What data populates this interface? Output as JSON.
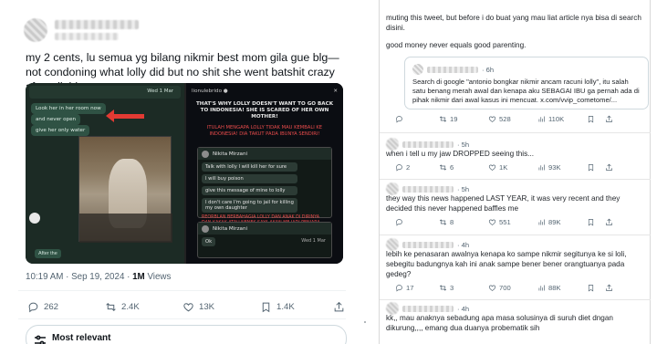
{
  "left": {
    "tweet_text": "my 2 cents, lu semua yg bilang nikmir best mom gila gue blg— not condoning what lolly did but no shit she went batshit crazy after all this",
    "media_left": {
      "chat_header": "Wed 1 Mar",
      "bubbles": [
        "Look her in her room now",
        "and never open",
        "give her only water"
      ],
      "after_label": "After the"
    },
    "media_right": {
      "handle": "lionulebrido ●",
      "title": "THAT'S WHY LOLLY DOESN'T WANT TO GO BACK TO INDONESIA! SHE IS SCARED OF HER OWN MOTHER!",
      "subtitle": "ITULAH MENGAPA LOLLY TIDAK MAU KEMBALI KE INDONESIA! DIA TAKUT PADA IBUNYA SENDIRI!",
      "chat1_name": "Nikita Mirzani",
      "chat1_messages": [
        "Talk with lolly I will kill her for sure",
        "I will buy poison",
        "give this message of mine to lolly",
        "I don't care I'm going to jail for killing my own daughter"
      ],
      "chat1_red": "REORBLAN BERBAHAGIA LOLLY DAN ANAK DI DIRINYA DAN KAKAK ATAU NENEK SAYA AKAN ME JADI PENJARA KARENA MEMBUNUH PUTRIKU SENDIRI",
      "chat2_name": "Nikita Mirzani",
      "chat2_messages": [
        "Ok"
      ],
      "chat2_date": "Wed 1 Mar"
    },
    "meta": {
      "time": "10:19 AM · Sep 19, 2024 · ",
      "views": "1M",
      "views_label": " Views"
    },
    "actions": {
      "replies": "262",
      "reposts": "2.4K",
      "likes": "13K",
      "bookmarks": "1.4K"
    },
    "relevant_label": "Most relevant"
  },
  "right": {
    "top_text": "muting this tweet, but before i do buat yang mau liat article nya bisa di search disini.",
    "second_text": "good money never equals good parenting.",
    "quote": {
      "time": "· 6h",
      "text": "Search di google \"antonio bongkar nikmir ancam racuni lolly\", itu salah satu benang merah awal dan kenapa aku SEBAGAI IBU ga pernah ada di pihak nikmir dari awal kasus ini mencuat. x.com/vvip_cometome/..."
    },
    "quote_stats": {
      "replies": "",
      "reposts": "19",
      "likes": "528",
      "views": "110K"
    },
    "replies": [
      {
        "time": "· 5h",
        "text": "when i tell u my jaw DROPPED seeing this...",
        "replies": "2",
        "reposts": "6",
        "likes": "1K",
        "views": "93K"
      },
      {
        "time": "· 5h",
        "text": "they way this news happened LAST YEAR, it was very recent and they decided this never happened baffles me",
        "replies": "",
        "reposts": "8",
        "likes": "551",
        "views": "89K"
      },
      {
        "time": "· 4h",
        "text": "lebih ke penasaran awalnya kenapa ko sampe nikmir segitunya ke si loli, sebegitu badungnya kah ini anak sampe bener bener orangtuanya pada gedeg?",
        "replies": "17",
        "reposts": "3",
        "likes": "700",
        "views": "88K"
      },
      {
        "time": "· 4h",
        "text": "kk,, mau anaknya sebadung apa masa solusinya di suruh diet dngan dikurung,,,, emang dua duanya probematik sih",
        "replies": "",
        "reposts": "",
        "likes": "",
        "views": ""
      }
    ]
  }
}
